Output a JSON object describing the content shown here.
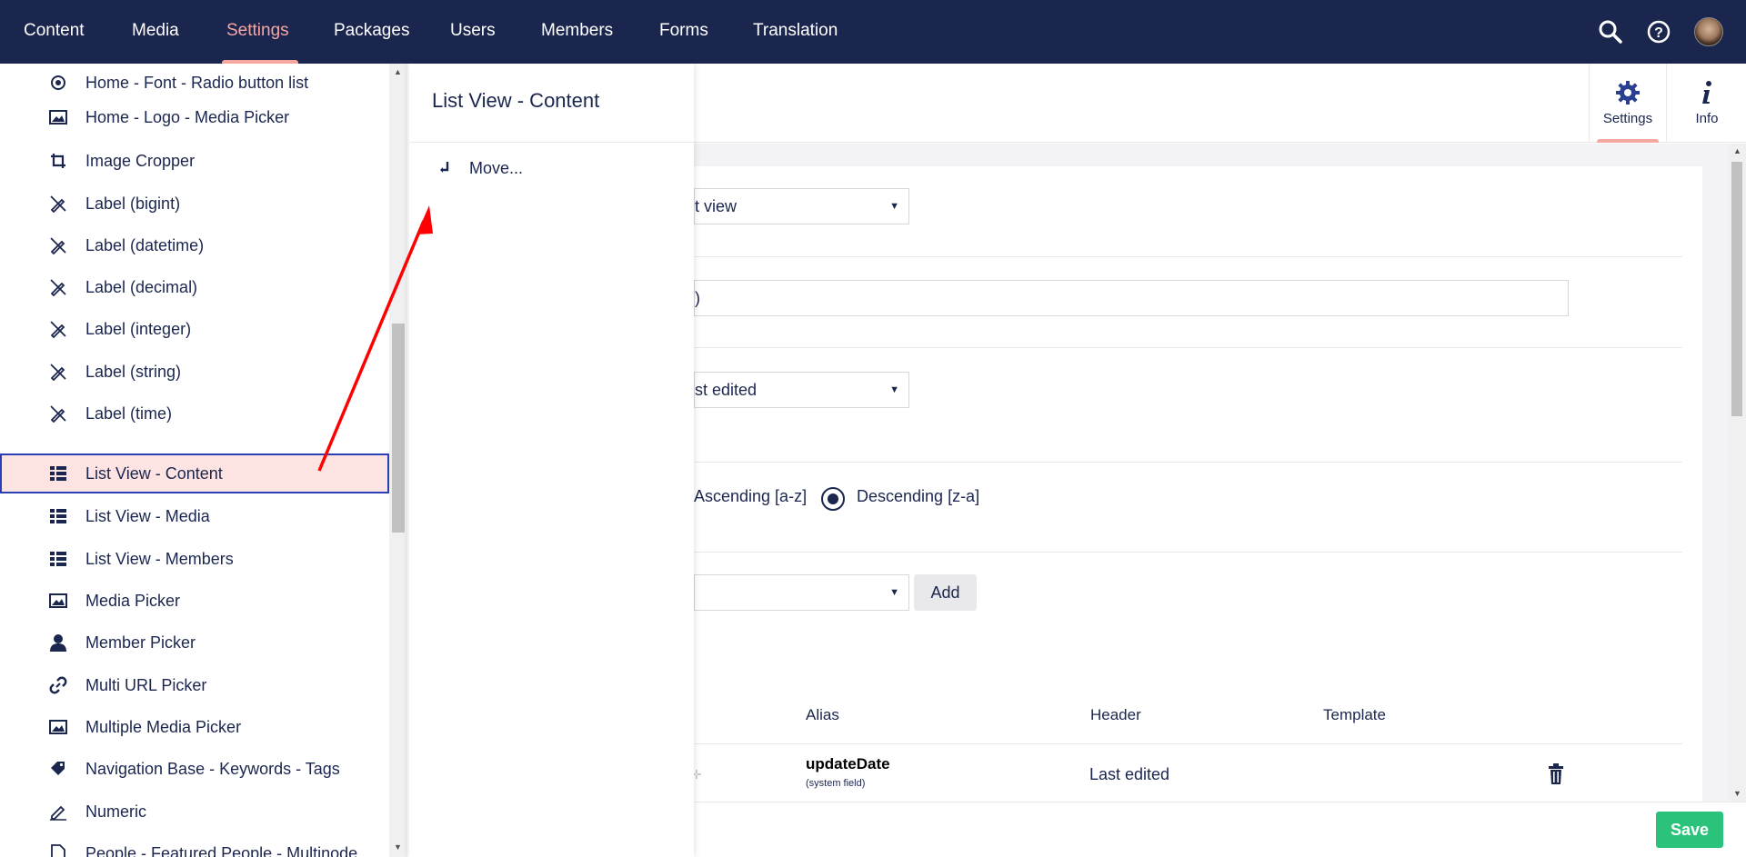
{
  "nav": {
    "items": [
      {
        "label": "Content"
      },
      {
        "label": "Media"
      },
      {
        "label": "Settings"
      },
      {
        "label": "Packages"
      },
      {
        "label": "Users"
      },
      {
        "label": "Members"
      },
      {
        "label": "Forms"
      },
      {
        "label": "Translation"
      }
    ],
    "active": "Settings",
    "icons": [
      "search-icon",
      "help-icon",
      "avatar"
    ]
  },
  "tree": {
    "items": [
      {
        "label": "Home - Font - Radio button list",
        "icon": "radio-icon"
      },
      {
        "label": "Home - Logo - Media Picker",
        "icon": "image-icon"
      },
      {
        "label": "Image Cropper",
        "icon": "crop-icon"
      },
      {
        "label": "Label (bigint)",
        "icon": "pencil-off-icon"
      },
      {
        "label": "Label (datetime)",
        "icon": "pencil-off-icon"
      },
      {
        "label": "Label (decimal)",
        "icon": "pencil-off-icon"
      },
      {
        "label": "Label (integer)",
        "icon": "pencil-off-icon"
      },
      {
        "label": "Label (string)",
        "icon": "pencil-off-icon"
      },
      {
        "label": "Label (time)",
        "icon": "pencil-off-icon"
      },
      {
        "label": "List View - Content",
        "icon": "list-icon"
      },
      {
        "label": "List View - Media",
        "icon": "list-icon"
      },
      {
        "label": "List View - Members",
        "icon": "list-icon"
      },
      {
        "label": "Media Picker",
        "icon": "image-icon"
      },
      {
        "label": "Member Picker",
        "icon": "user-icon"
      },
      {
        "label": "Multi URL Picker",
        "icon": "link-icon"
      },
      {
        "label": "Multiple Media Picker",
        "icon": "image-icon"
      },
      {
        "label": "Navigation Base - Keywords - Tags",
        "icon": "tags-icon"
      },
      {
        "label": "Numeric",
        "icon": "pencil-icon"
      },
      {
        "label": "People - Featured People - Multinode",
        "icon": "document-icon"
      }
    ],
    "selected": "List View - Content"
  },
  "dialog": {
    "title": "List View - Content",
    "actions": [
      {
        "label": "Move...",
        "icon": "move-icon"
      }
    ]
  },
  "app_tabs": [
    {
      "label": "Settings",
      "icon": "gear-icon",
      "active": true
    },
    {
      "label": "Info",
      "icon": "info-icon",
      "active": false
    }
  ],
  "form": {
    "layout_select": "t view",
    "text_value": ")",
    "order_by_select": "st edited",
    "order_direction": {
      "ascending_label": "Ascending [a-z]",
      "descending_label": "Descending [z-a]",
      "selected": "Descending [z-a]"
    },
    "add_property_select": "",
    "add_button": "Add"
  },
  "columns_table": {
    "headers": [
      "Alias",
      "Header",
      "Template"
    ],
    "rows": [
      {
        "alias": "updateDate",
        "note": "(system field)",
        "header": "Last edited",
        "template": ""
      }
    ]
  },
  "footer": {
    "save_label": "Save"
  },
  "colors": {
    "nav_bg": "#1b264f",
    "active_accent": "#f5a7a1",
    "selection_bg": "#fde3e2",
    "selection_border": "#2a3fb3",
    "save_green": "#2bc37c",
    "annotation_arrow": "#ff0000"
  }
}
